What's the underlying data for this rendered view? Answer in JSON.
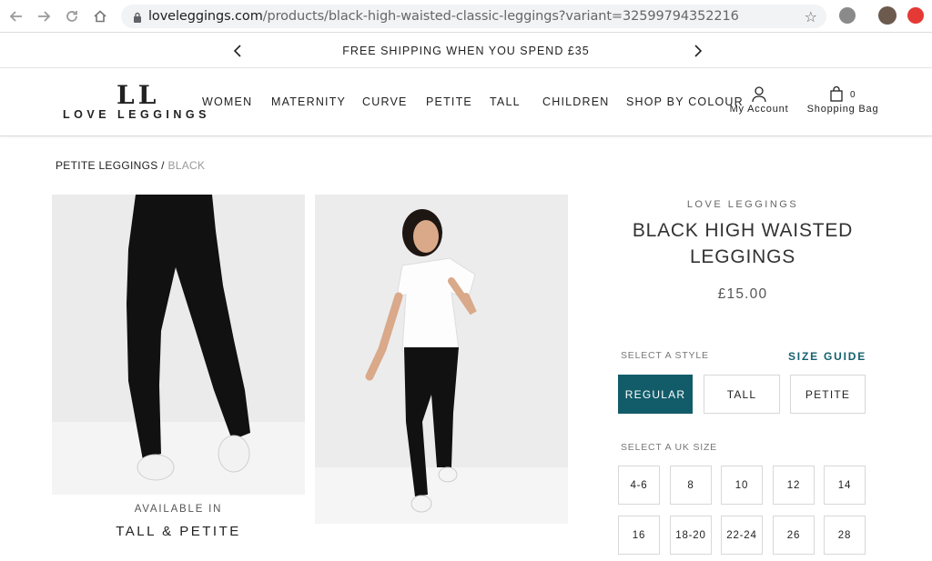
{
  "browser": {
    "url_host": "loveleggings.com",
    "url_path": "/products/black-high-waisted-classic-leggings?variant=32599794352216"
  },
  "announcement": {
    "text": "FREE SHIPPING WHEN YOU SPEND £35"
  },
  "header": {
    "logo_mark": "LL",
    "logo_text": "LOVE LEGGINGS",
    "nav": [
      "WOMEN",
      "MATERNITY",
      "CURVE",
      "PETITE",
      "TALL",
      "CHILDREN",
      "SHOP BY COLOUR"
    ],
    "account_label": "My Account",
    "bag_label": "Shopping Bag",
    "bag_count": "0"
  },
  "breadcrumb": {
    "parent": "PETITE LEGGINGS",
    "separator": "/",
    "current": "BLACK"
  },
  "promo": {
    "line1": "AVAILABLE IN",
    "line2": "TALL & PETITE"
  },
  "product": {
    "brand": "LOVE LEGGINGS",
    "title_line1": "BLACK HIGH WAISTED",
    "title_line2": "LEGGINGS",
    "price": "£15.00",
    "style_label": "SELECT A STYLE",
    "size_guide": "SIZE GUIDE",
    "styles": [
      "REGULAR",
      "TALL",
      "PETITE"
    ],
    "selected_style": "REGULAR",
    "size_label": "SELECT A UK SIZE",
    "sizes": [
      "4-6",
      "8",
      "10",
      "12",
      "14",
      "16",
      "18-20",
      "22-24",
      "26",
      "28"
    ]
  },
  "colors": {
    "accent": "#125c6a"
  }
}
